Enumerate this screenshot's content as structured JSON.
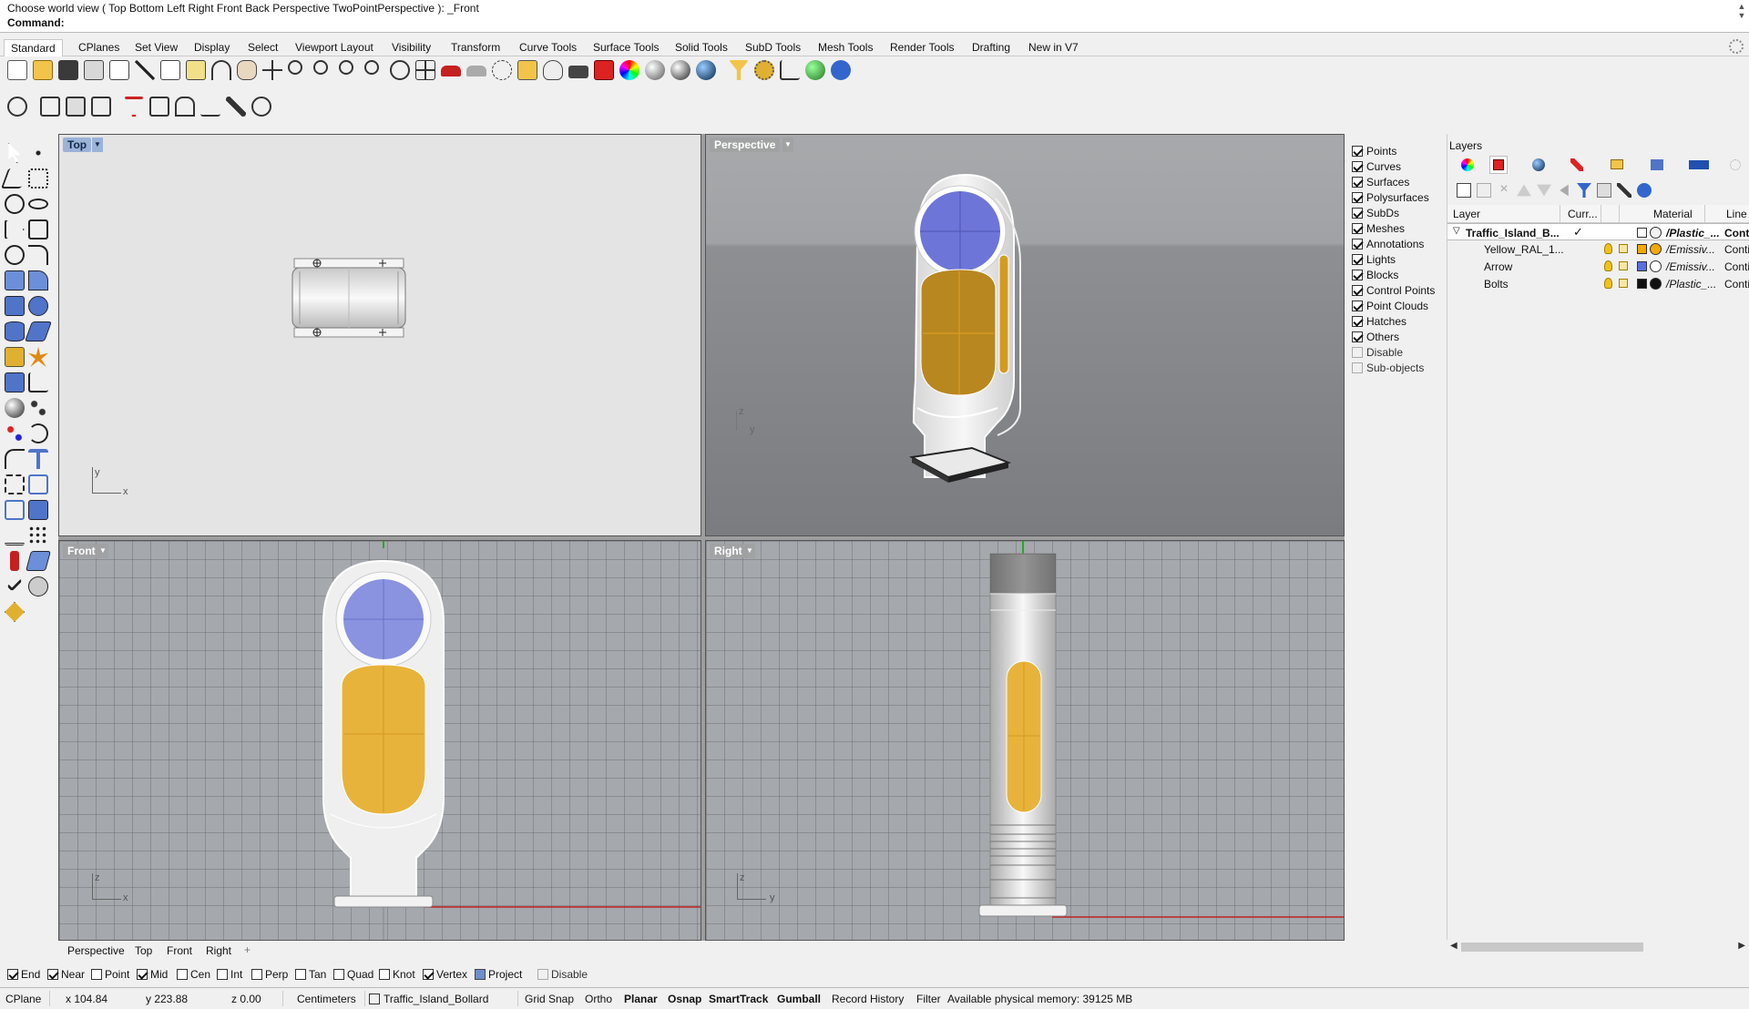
{
  "command": {
    "prompt": "Choose world view ( Top  Bottom  Left  Right  Front  Back  Perspective  TwoPointPerspective ): _Front",
    "label": "Command:"
  },
  "tabs": [
    "Standard",
    "CPlanes",
    "Set View",
    "Display",
    "Select",
    "Viewport Layout",
    "Visibility",
    "Transform",
    "Curve Tools",
    "Surface Tools",
    "Solid Tools",
    "SubD Tools",
    "Mesh Tools",
    "Render Tools",
    "Drafting",
    "New in V7"
  ],
  "viewports": {
    "top": "Top",
    "perspective": "Perspective",
    "front": "Front",
    "right": "Right"
  },
  "axes": {
    "top": {
      "h": "x",
      "v": "y"
    },
    "persp": {
      "h": "y",
      "v": "z"
    },
    "front": {
      "h": "x",
      "v": "z"
    },
    "right": {
      "h": "y",
      "v": "z"
    }
  },
  "viewport_tabs": [
    "Perspective",
    "Top",
    "Front",
    "Right"
  ],
  "viewport_tab_add": "+",
  "filters": [
    {
      "label": "Points",
      "checked": true
    },
    {
      "label": "Curves",
      "checked": true
    },
    {
      "label": "Surfaces",
      "checked": true
    },
    {
      "label": "Polysurfaces",
      "checked": true
    },
    {
      "label": "SubDs",
      "checked": true
    },
    {
      "label": "Meshes",
      "checked": true
    },
    {
      "label": "Annotations",
      "checked": true
    },
    {
      "label": "Lights",
      "checked": true
    },
    {
      "label": "Blocks",
      "checked": true
    },
    {
      "label": "Control Points",
      "checked": true
    },
    {
      "label": "Point Clouds",
      "checked": true
    },
    {
      "label": "Hatches",
      "checked": true
    },
    {
      "label": "Others",
      "checked": true
    },
    {
      "label": "Disable",
      "checked": false
    },
    {
      "label": "Sub-objects",
      "checked": false
    }
  ],
  "layers": {
    "title": "Layers",
    "headers": {
      "layer": "Layer",
      "current": "Curr...",
      "material": "Material",
      "line": "Line"
    },
    "rows": [
      {
        "name": "Traffic_Island_B...",
        "current": "✓",
        "material": "/Plastic_...",
        "line": "Conti",
        "color": "#ffffff",
        "mat_color": "#f2f2f2",
        "bold": true
      },
      {
        "name": "Yellow_RAL_1...",
        "current": "",
        "material": "/Emissiv...",
        "line": "Conti",
        "color": "#f2a900",
        "mat_color": "#f2a900",
        "bold": false
      },
      {
        "name": "Arrow",
        "current": "",
        "material": "/Emissiv...",
        "line": "Conti",
        "color": "#5a6fe0",
        "mat_color": "#ffffff",
        "bold": false
      },
      {
        "name": "Bolts",
        "current": "",
        "material": "/Plastic_...",
        "line": "Conti",
        "color": "#111111",
        "mat_color": "#111111",
        "bold": false
      }
    ]
  },
  "osnaps": [
    {
      "label": "End",
      "checked": true
    },
    {
      "label": "Near",
      "checked": true
    },
    {
      "label": "Point",
      "checked": false
    },
    {
      "label": "Mid",
      "checked": true
    },
    {
      "label": "Cen",
      "checked": false
    },
    {
      "label": "Int",
      "checked": false
    },
    {
      "label": "Perp",
      "checked": false
    },
    {
      "label": "Tan",
      "checked": false
    },
    {
      "label": "Quad",
      "checked": false
    },
    {
      "label": "Knot",
      "checked": false
    },
    {
      "label": "Vertex",
      "checked": true
    },
    {
      "label": "Project",
      "checked": "blue"
    },
    {
      "label": "Disable",
      "checked": false
    }
  ],
  "status": {
    "cplane": "CPlane",
    "x": "x 104.84",
    "y": "y 223.88",
    "z": "z 0.00",
    "units": "Centimeters",
    "layer": "Traffic_Island_Bollard",
    "grid_snap": "Grid Snap",
    "ortho": "Ortho",
    "planar": "Planar",
    "osnap": "Osnap",
    "smarttrack": "SmartTrack",
    "gumball": "Gumball",
    "record_history": "Record History",
    "filter": "Filter",
    "memory": "Available physical memory: 39125 MB"
  },
  "colors": {
    "yellow": "#e8b33a",
    "blue": "#8a93e0",
    "viewport_active": "#9bb3d8",
    "x_axis": "#c02020",
    "z_axis": "#20a020"
  }
}
